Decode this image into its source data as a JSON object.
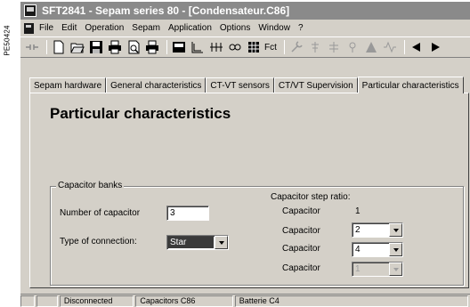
{
  "side_reference": "PE50424",
  "window": {
    "title": "SFT2841 - Sepam series 80 - [Condensateur.C86]"
  },
  "menu": [
    "File",
    "Edit",
    "Operation",
    "Sepam",
    "Application",
    "Options",
    "Window",
    "?"
  ],
  "toolbar": {
    "function_label": "Fct"
  },
  "tabs": [
    {
      "label": "Sepam hardware",
      "active": false
    },
    {
      "label": "General characteristics",
      "active": false
    },
    {
      "label": "CT-VT sensors",
      "active": false
    },
    {
      "label": "CT/VT Supervision",
      "active": false
    },
    {
      "label": "Particular characteristics",
      "active": true
    }
  ],
  "panel": {
    "title": "Particular characteristics",
    "group": {
      "label": "Capacitor banks",
      "number_label": "Number of capacitor",
      "number_value": "3",
      "connection_label": "Type of connection:",
      "connection_value": "Star",
      "step_ratio_label": "Capacitor step ratio:",
      "capacitors": [
        {
          "label": "Capacitor",
          "value": "1",
          "kind": "static"
        },
        {
          "label": "Capacitor",
          "value": "2",
          "kind": "combo"
        },
        {
          "label": "Capacitor",
          "value": "4",
          "kind": "combo"
        },
        {
          "label": "Capacitor",
          "value": "1",
          "kind": "disabled"
        }
      ]
    }
  },
  "status": {
    "connection": "Disconnected",
    "model": "Capacitors C86",
    "battery": "Batterie C4"
  }
}
